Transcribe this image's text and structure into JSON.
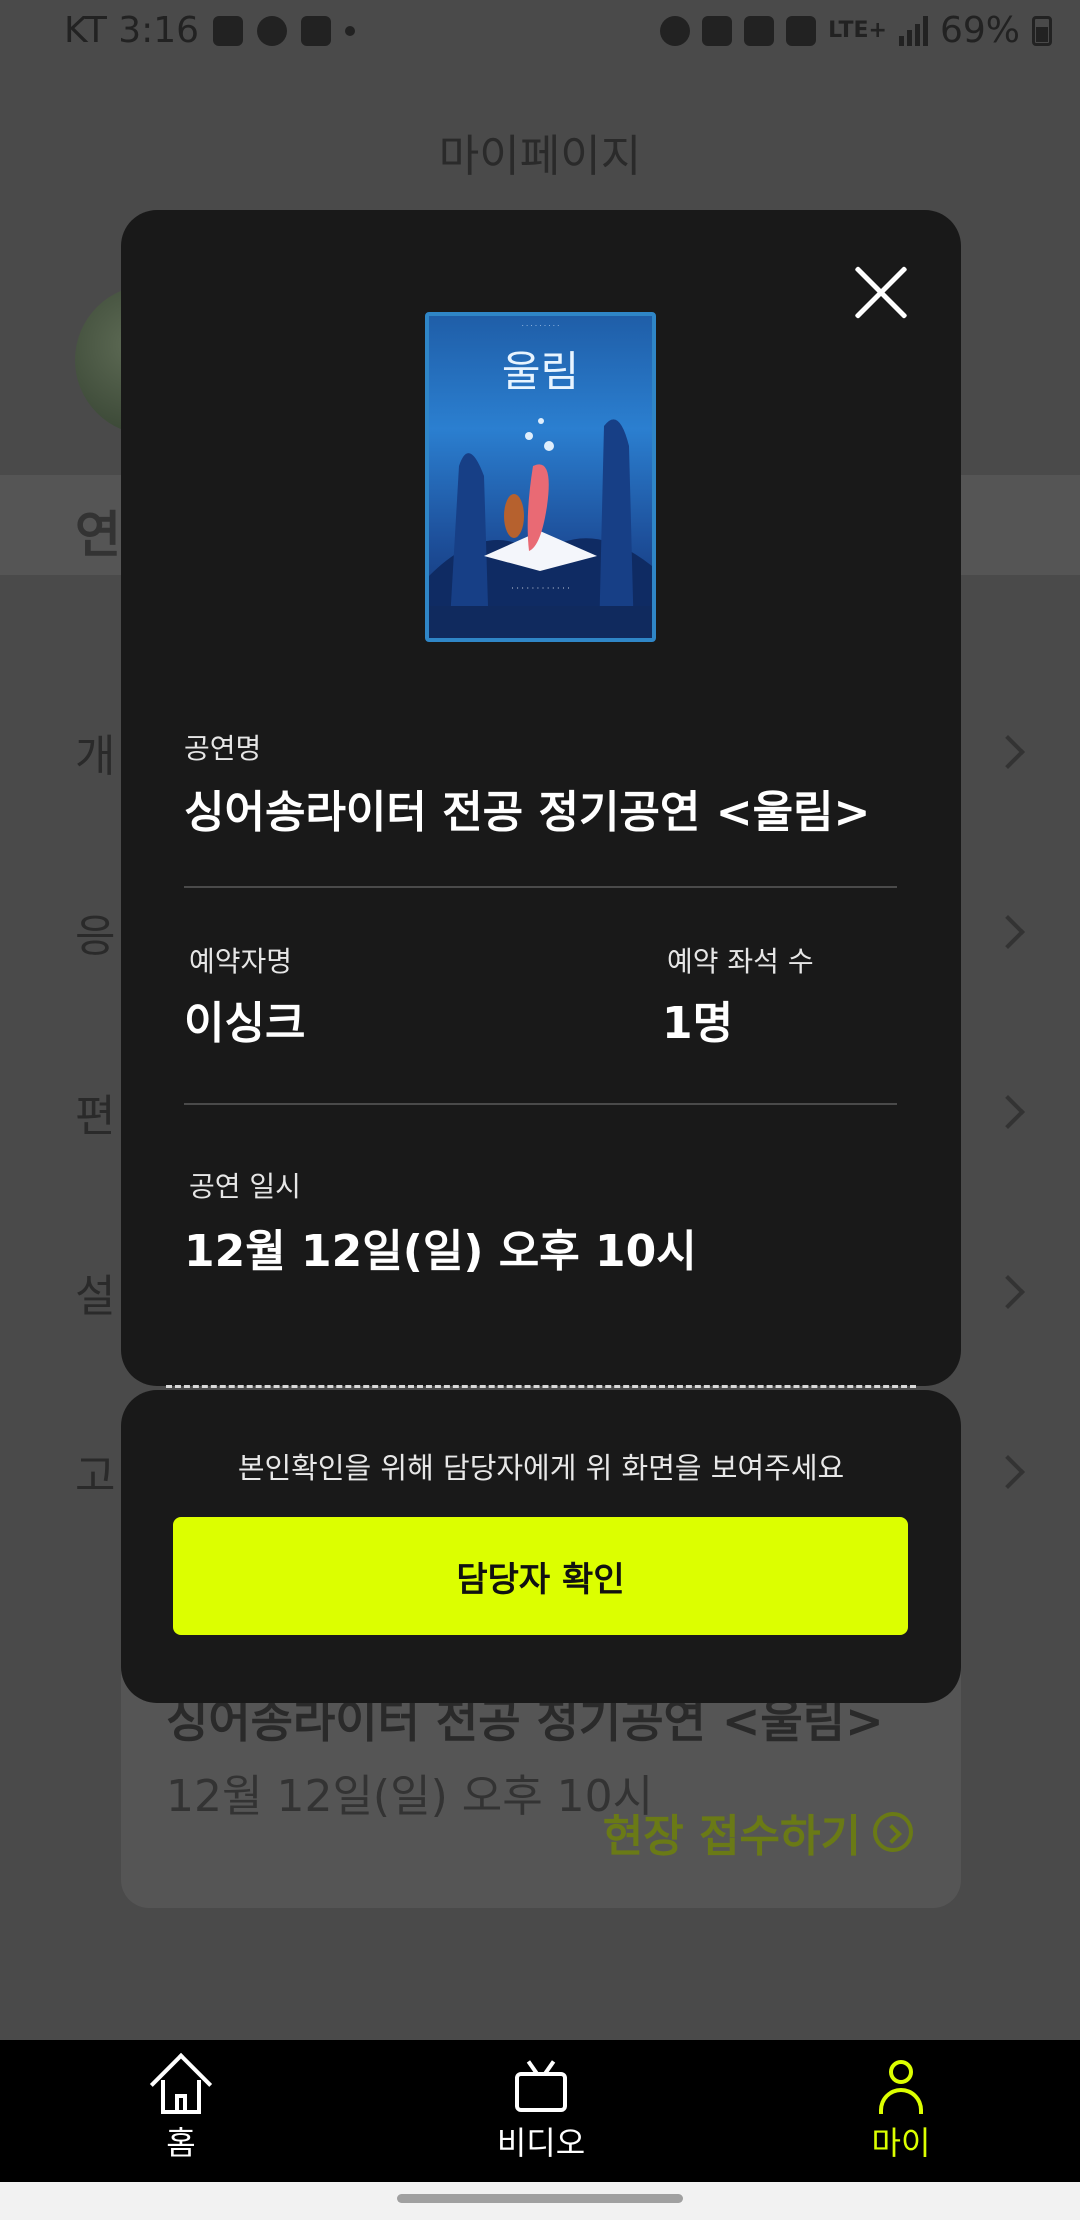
{
  "status_bar": {
    "carrier_time": "KT 3:16",
    "network": "LTE+",
    "battery": "69%"
  },
  "page": {
    "title": "마이페이지",
    "bg_tab_partial": "연",
    "bg_rows": [
      "개",
      "응",
      "편",
      "설",
      "고"
    ]
  },
  "bg_card": {
    "title": "싱어송라이터 전공 정기공연 <울림>",
    "date": "12월 12일(일) 오후 10시",
    "action": "현장 접수하기"
  },
  "poster": {
    "title": "울림"
  },
  "ticket": {
    "performance_label": "공연명",
    "performance_name": "싱어송라이터 전공 정기공연 <울림>",
    "booker_label": "예약자명",
    "booker_name": "이싱크",
    "seats_label": "예약 좌석 수",
    "seats_value": "1명",
    "datetime_label": "공연 일시",
    "datetime_value": "12월 12일(일) 오후 10시",
    "notice": "본인확인을 위해 담당자에게 위 화면을 보여주세요",
    "confirm_button": "담당자 확인"
  },
  "bottom_nav": {
    "items": [
      {
        "label": "홈",
        "icon": "home-icon"
      },
      {
        "label": "비디오",
        "icon": "tv-icon"
      },
      {
        "label": "마이",
        "icon": "user-icon",
        "active": true
      }
    ]
  },
  "colors": {
    "accent": "#dcff00",
    "modal_bg": "#191919",
    "overlay_bg": "#4a4a4a"
  }
}
